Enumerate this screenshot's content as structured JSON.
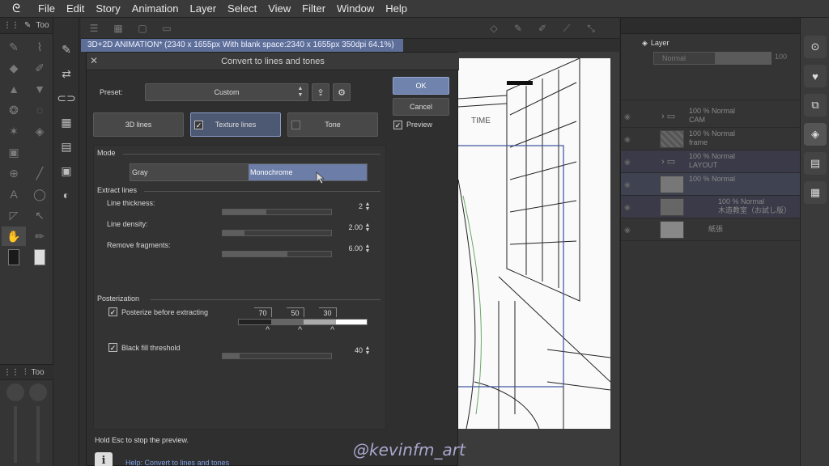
{
  "menubar": {
    "items": [
      "File",
      "Edit",
      "Story",
      "Animation",
      "Layer",
      "Select",
      "View",
      "Filter",
      "Window",
      "Help"
    ]
  },
  "left_panel": {
    "tool_tab_label": "Too",
    "sub_tool_tab_label": "Too"
  },
  "document": {
    "tab_title": "3D+2D ANIMATION* (2340 x 1655px With blank space:2340 x 1655px 350dpi 64.1%)"
  },
  "dialog": {
    "title": "Convert to lines and tones",
    "preset_label": "Preset:",
    "preset_value": "Custom",
    "tabs": [
      {
        "label": "3D lines",
        "checked": false
      },
      {
        "label": "Texture lines",
        "checked": true
      },
      {
        "label": "Tone",
        "checked": false
      }
    ],
    "ok_label": "OK",
    "cancel_label": "Cancel",
    "preview_label": "Preview",
    "preview_checked": true,
    "mode": {
      "section_label": "Mode",
      "options": [
        "Gray",
        "Monochrome"
      ],
      "selected": "Monochrome"
    },
    "extract_lines": {
      "section_label": "Extract lines",
      "line_thickness": {
        "label": "Line thickness:",
        "value": "2",
        "fraction": 0.4
      },
      "line_density": {
        "label": "Line density:",
        "value": "2.00",
        "fraction": 0.2
      },
      "remove_fragments": {
        "label": "Remove fragments:",
        "value": "6.00",
        "fraction": 0.6
      }
    },
    "posterization": {
      "section_label": "Posterization",
      "posterize_label": "Posterize before extracting",
      "posterize_checked": true,
      "levels": [
        "70",
        "50",
        "30"
      ],
      "black_fill_label": "Black fill threshold",
      "black_fill_checked": true,
      "black_fill_value": "40",
      "black_fill_fraction": 0.16
    },
    "footer_note": "Hold Esc to stop the preview.",
    "help_link": "Help: Convert to lines and tones"
  },
  "canvas": {
    "sign_text": "TIME"
  },
  "layer_panel": {
    "tab_label": "Layer",
    "blend_mode": "Normal",
    "opacity": "100",
    "layers": [
      {
        "line1": "100 % Normal",
        "line2": "CAM",
        "type": "folder"
      },
      {
        "line1": "100 % Normal",
        "line2": "frame",
        "type": "raster"
      },
      {
        "line1": "100 % Normal",
        "line2": "LAYOUT",
        "type": "folder"
      },
      {
        "line1": "100 % Normal",
        "line2": "",
        "type": "raster",
        "selected": true
      },
      {
        "line1": "100 % Normal",
        "line2": "木造教室（お試し版）",
        "type": "3d"
      },
      {
        "line1": "紙張",
        "line2": "",
        "type": "paper"
      }
    ]
  },
  "watermark": "@kevinfm_art",
  "colors": {
    "accent": "#6f83ad",
    "selected_tab": "#4d5873",
    "doc_tab": "#5d6f98"
  }
}
